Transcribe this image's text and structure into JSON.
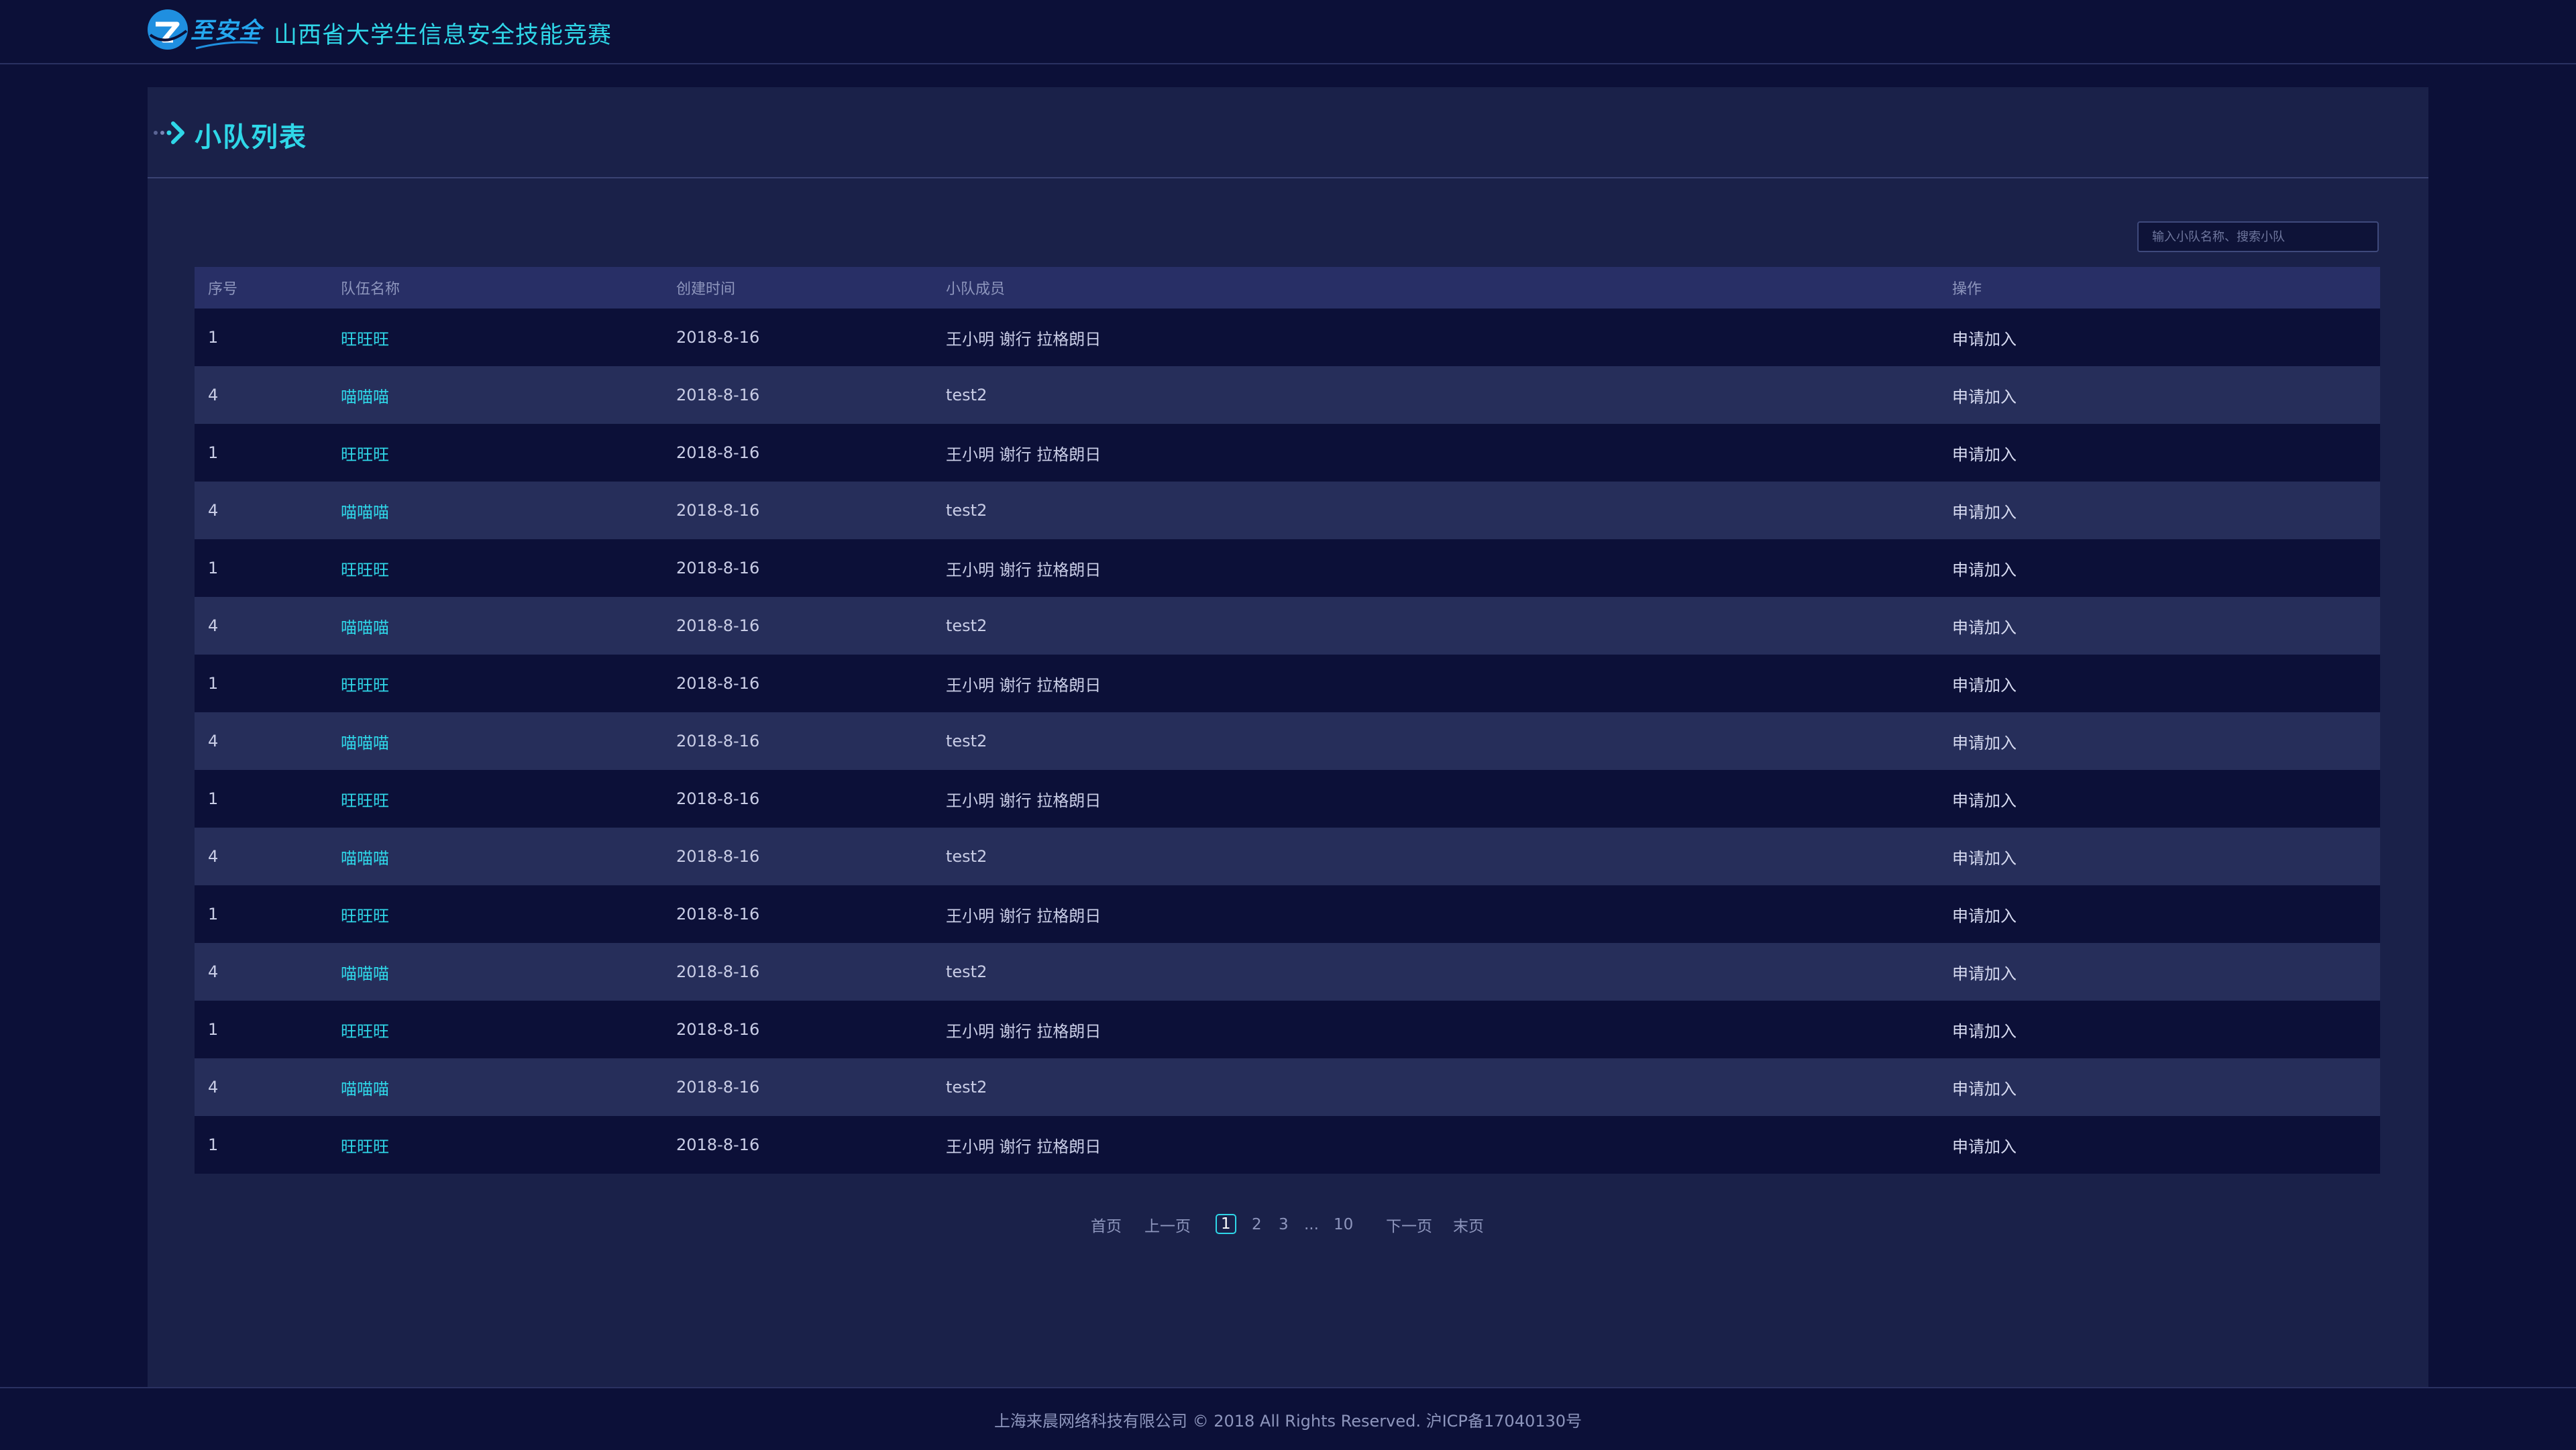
{
  "header": {
    "logo_text": "至安全",
    "site_title": "山西省大学生信息安全技能竞赛"
  },
  "panel": {
    "title": "小队列表",
    "search_placeholder": "输入小队名称、搜索小队"
  },
  "table": {
    "columns": [
      "序号",
      "队伍名称",
      "创建时间",
      "小队成员",
      "操作"
    ],
    "rows": [
      {
        "no": "1",
        "name": "旺旺旺",
        "created": "2018-8-16",
        "members": "王小明  谢行  拉格朗日",
        "action": "申请加入"
      },
      {
        "no": "4",
        "name": "喵喵喵",
        "created": "2018-8-16",
        "members": "test2",
        "action": "申请加入"
      },
      {
        "no": "1",
        "name": "旺旺旺",
        "created": "2018-8-16",
        "members": "王小明  谢行  拉格朗日",
        "action": "申请加入"
      },
      {
        "no": "4",
        "name": "喵喵喵",
        "created": "2018-8-16",
        "members": "test2",
        "action": "申请加入"
      },
      {
        "no": "1",
        "name": "旺旺旺",
        "created": "2018-8-16",
        "members": "王小明  谢行  拉格朗日",
        "action": "申请加入"
      },
      {
        "no": "4",
        "name": "喵喵喵",
        "created": "2018-8-16",
        "members": "test2",
        "action": "申请加入"
      },
      {
        "no": "1",
        "name": "旺旺旺",
        "created": "2018-8-16",
        "members": "王小明  谢行  拉格朗日",
        "action": "申请加入"
      },
      {
        "no": "4",
        "name": "喵喵喵",
        "created": "2018-8-16",
        "members": "test2",
        "action": "申请加入"
      },
      {
        "no": "1",
        "name": "旺旺旺",
        "created": "2018-8-16",
        "members": "王小明  谢行  拉格朗日",
        "action": "申请加入"
      },
      {
        "no": "4",
        "name": "喵喵喵",
        "created": "2018-8-16",
        "members": "test2",
        "action": "申请加入"
      },
      {
        "no": "1",
        "name": "旺旺旺",
        "created": "2018-8-16",
        "members": "王小明  谢行  拉格朗日",
        "action": "申请加入"
      },
      {
        "no": "4",
        "name": "喵喵喵",
        "created": "2018-8-16",
        "members": "test2",
        "action": "申请加入"
      },
      {
        "no": "1",
        "name": "旺旺旺",
        "created": "2018-8-16",
        "members": "王小明  谢行  拉格朗日",
        "action": "申请加入"
      },
      {
        "no": "4",
        "name": "喵喵喵",
        "created": "2018-8-16",
        "members": "test2",
        "action": "申请加入"
      },
      {
        "no": "1",
        "name": "旺旺旺",
        "created": "2018-8-16",
        "members": "王小明  谢行  拉格朗日",
        "action": "申请加入"
      }
    ]
  },
  "pagination": {
    "first": "首页",
    "prev": "上一页",
    "pages": [
      "1",
      "2",
      "3"
    ],
    "ellipsis": "...",
    "last_page": "10",
    "next": "下一页",
    "last": "末页",
    "current": "1"
  },
  "footer": {
    "text": "上海来晨网络科技有限公司 © 2018 All Rights Reserved.   沪ICP备17040130号"
  },
  "colors": {
    "background": "#0c1038",
    "panel": "#1a2149",
    "accent": "#2fd7e8",
    "table_header": "#282f66",
    "row_alt": "#262e5a"
  }
}
